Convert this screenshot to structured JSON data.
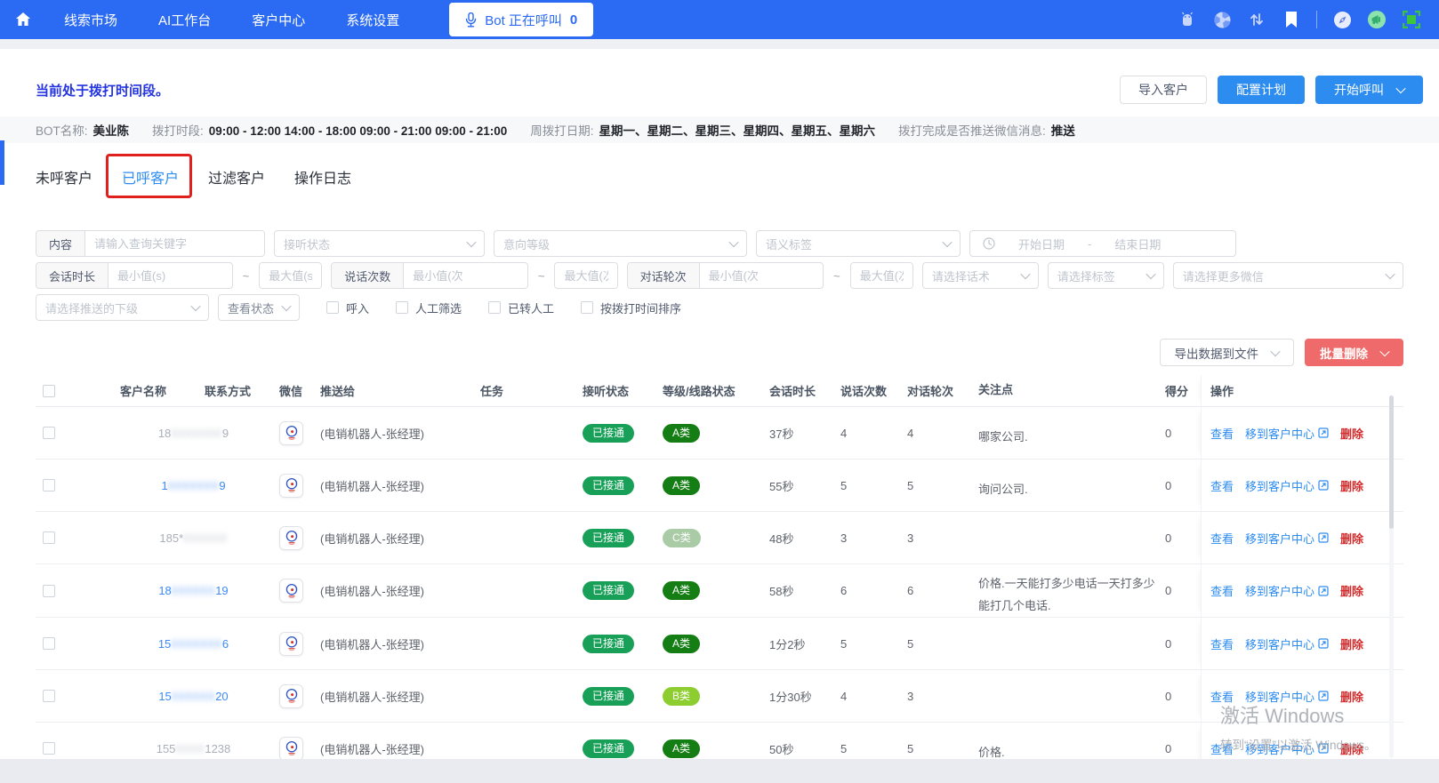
{
  "theme": {
    "nav_blue": "#2b6af2",
    "link_blue": "#2d8cf0",
    "success_green": "#18a058",
    "grade_a_green": "#147d14",
    "grade_b_green": "#8ecd2f",
    "grade_c_green": "#a9cba5",
    "danger_red": "#ef6a6a",
    "delete_red": "#d42c2c",
    "status_blue": "#2334e0",
    "annotation_red": "#e0201c"
  },
  "nav": {
    "items": [
      {
        "label": "线索市场"
      },
      {
        "label": "AI工作台"
      },
      {
        "label": "客户中心"
      },
      {
        "label": "系统设置"
      }
    ],
    "bot_button": {
      "label": "Bot 正在呼叫",
      "count": "0"
    }
  },
  "page": {
    "status_text": "当前处于拨打时间段。",
    "actions": {
      "import": "导入客户",
      "configure": "配置计划",
      "start_call": "开始呼叫"
    }
  },
  "info_bar": {
    "fields": [
      {
        "label": "BOT名称:",
        "value": "美业陈",
        "bold": true
      },
      {
        "label": "拨打时段:",
        "value": "09:00 - 12:00 14:00 - 18:00 09:00 - 21:00 09:00 - 21:00",
        "bold": true
      },
      {
        "label": "周拨打日期:",
        "value": "星期一、星期二、星期三、星期四、星期五、星期六",
        "bold": true
      },
      {
        "label": "拨打完成是否推送微信消息:",
        "value": "推送",
        "bold": true
      }
    ]
  },
  "tabs": [
    {
      "label": "未呼客户",
      "active": false,
      "annotated": false
    },
    {
      "label": "已呼客户",
      "active": true,
      "annotated": true
    },
    {
      "label": "过滤客户",
      "active": false,
      "annotated": false
    },
    {
      "label": "操作日志",
      "active": false,
      "annotated": false
    }
  ],
  "filters": {
    "row1": {
      "content_label": "内容",
      "keyword_placeholder": "请输入查询关键字",
      "listen_status": "接听状态",
      "intent_level": "意向等级",
      "semantic_tag": "语义标签",
      "start_date": "开始日期",
      "date_separator": "-",
      "end_date": "结束日期"
    },
    "row2": {
      "session_label": "会话时长",
      "min_s": "最小值(s)",
      "max_s": "最大值(s)",
      "tilde": "~",
      "talk_label": "说话次数",
      "min_times": "最小值(次",
      "max_times": "最大值(次",
      "round_label": "对话轮次",
      "script_select": "请选择话术",
      "tag_select": "请选择标签",
      "wechat_select": "请选择更多微信"
    },
    "row3": {
      "subordinate_select": "请选择推送的下级",
      "view_status": "查看状态",
      "checkboxes": [
        "呼入",
        "人工筛选",
        "已转人工",
        "按拨打时间排序"
      ]
    }
  },
  "list_actions": {
    "export": "导出数据到文件",
    "batch_delete": "批量删除"
  },
  "table": {
    "headers": [
      "客户名称",
      "联系方式",
      "微信",
      "推送给",
      "任务",
      "接听状态",
      "等级/线路状态",
      "会话时长",
      "说话次数",
      "对话轮次",
      "关注点",
      "得分",
      "操作"
    ],
    "action_labels": {
      "view": "查看",
      "move": "移到客户中心",
      "delete": "删除"
    },
    "rows": [
      {
        "phone_prefix": "18",
        "phone_mask": "8888888",
        "phone_suffix": "9",
        "phone_color": "grey",
        "pushed_to": "(电销机器人-张经理)",
        "status": "已接通",
        "grade": "A类",
        "grade_key": "a",
        "duration": "37秒",
        "talks": "4",
        "rounds": "4",
        "focus": "哪家公司.",
        "score": "0"
      },
      {
        "phone_prefix": "1",
        "phone_mask": "8888888",
        "phone_suffix": "9",
        "phone_color": "blue",
        "pushed_to": "(电销机器人-张经理)",
        "status": "已接通",
        "grade": "A类",
        "grade_key": "a",
        "duration": "55秒",
        "talks": "5",
        "rounds": "5",
        "focus": "询问公司.",
        "score": "0"
      },
      {
        "phone_prefix": "185*",
        "phone_mask": "888888",
        "phone_suffix": "",
        "phone_color": "grey",
        "pushed_to": "(电销机器人-张经理)",
        "status": "已接通",
        "grade": "C类",
        "grade_key": "c",
        "duration": "48秒",
        "talks": "3",
        "rounds": "3",
        "focus": "",
        "score": "0"
      },
      {
        "phone_prefix": "18",
        "phone_mask": "888888",
        "phone_suffix": "19",
        "phone_color": "blue",
        "pushed_to": "(电销机器人-张经理)",
        "status": "已接通",
        "grade": "A类",
        "grade_key": "a",
        "duration": "58秒",
        "talks": "6",
        "rounds": "6",
        "focus": "价格.一天能打多少电话一天打多少能打几个电话.",
        "score": "0"
      },
      {
        "phone_prefix": "15",
        "phone_mask": "8888888",
        "phone_suffix": "6",
        "phone_color": "blue",
        "pushed_to": "(电销机器人-张经理)",
        "status": "已接通",
        "grade": "A类",
        "grade_key": "a",
        "duration": "1分2秒",
        "talks": "5",
        "rounds": "5",
        "focus": "",
        "score": "0"
      },
      {
        "phone_prefix": "15",
        "phone_mask": "888888",
        "phone_suffix": "20",
        "phone_color": "blue",
        "pushed_to": "(电销机器人-张经理)",
        "status": "已接通",
        "grade": "B类",
        "grade_key": "b",
        "duration": "1分30秒",
        "talks": "4",
        "rounds": "3",
        "focus": "",
        "score": "0"
      },
      {
        "phone_prefix": "155",
        "phone_mask": "8888",
        "phone_suffix": "1238",
        "phone_color": "grey",
        "pushed_to": "(电销机器人-张经理)",
        "status": "已接通",
        "grade": "A类",
        "grade_key": "a",
        "duration": "50秒",
        "talks": "5",
        "rounds": "5",
        "focus": "价格.",
        "score": "0"
      }
    ]
  },
  "watermark": {
    "line1": "激活 Windows",
    "line2": "转到“设置”以激活 Windows。"
  }
}
